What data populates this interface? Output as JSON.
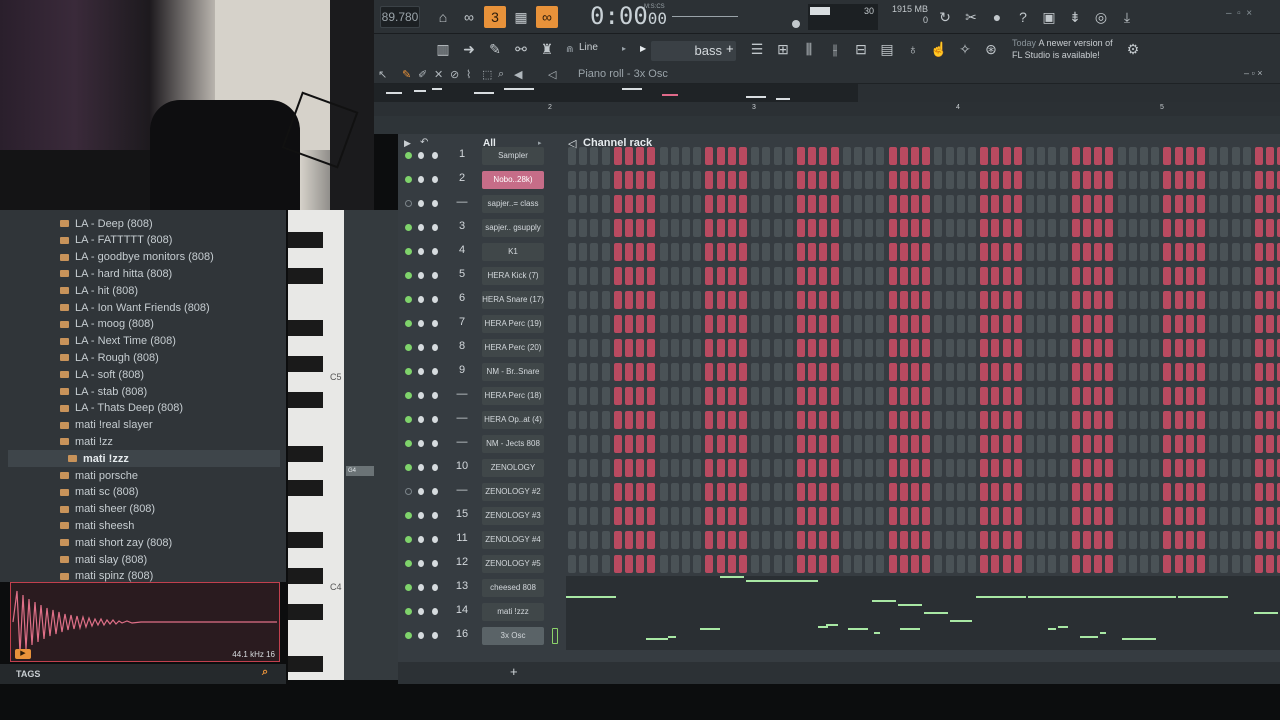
{
  "topbar": {
    "tempo": "89.780",
    "time": "0:00",
    "time_small": "00",
    "time_label": "M:S:CS",
    "cpu_value": "30",
    "memory": "1915 MB",
    "memory_sub": "0",
    "pattern": "bass",
    "snap": "Line",
    "news_title": "Today",
    "news_line1": "A newer version of",
    "news_line2": "FL Studio is available!"
  },
  "piano_roll": {
    "title": "Piano roll - 3x Osc"
  },
  "timeline": [
    "2",
    "3",
    "4",
    "5"
  ],
  "browser": {
    "items": [
      "LA - Deep (808)",
      "LA - FATTTTT (808)",
      "LA - goodbye monitors (808)",
      "LA - hard hitta (808)",
      "LA - hit (808)",
      "LA - Ion Want Friends (808)",
      "LA - moog (808)",
      "LA - Next Time (808)",
      "LA - Rough (808)",
      "LA - soft (808)",
      "LA - stab (808)",
      "LA - Thats Deep (808)",
      "mati !real slayer",
      "mati !zz",
      "mati !zzz",
      "mati porsche",
      "mati sc (808)",
      "mati sheer (808)",
      "mati sheesh",
      "mati short zay (808)",
      "mati slay (808)",
      "mati spinz (808)"
    ],
    "selected_index": 14,
    "sample_rate": "44.1 kHz 16",
    "tags_label": "TAGS"
  },
  "keyboard": {
    "c5": "C5",
    "c4": "C4",
    "g4": "G4"
  },
  "channel_rack": {
    "title": "Channel rack",
    "filter": "All",
    "add_label": "+",
    "channels": [
      {
        "num": "1",
        "name": "Sampler",
        "on": true
      },
      {
        "num": "2",
        "name": "Nobo..28k)",
        "on": true,
        "highlight": true
      },
      {
        "num": "—",
        "name": "sapjer..= class",
        "on": false
      },
      {
        "num": "3",
        "name": "sapjer.. gsupply",
        "on": true
      },
      {
        "num": "4",
        "name": "K1",
        "on": true
      },
      {
        "num": "5",
        "name": "HERA Kick (7)",
        "on": true
      },
      {
        "num": "6",
        "name": "HERA Snare (17)",
        "on": true
      },
      {
        "num": "7",
        "name": "HERA Perc (19)",
        "on": true
      },
      {
        "num": "8",
        "name": "HERA Perc (20)",
        "on": true
      },
      {
        "num": "9",
        "name": "NM - Br..Snare",
        "on": true
      },
      {
        "num": "—",
        "name": "HERA Perc (18)",
        "on": true
      },
      {
        "num": "—",
        "name": "HERA Op..at (4)",
        "on": true
      },
      {
        "num": "—",
        "name": "NM - Jects 808",
        "on": true
      },
      {
        "num": "10",
        "name": "ZENOLOGY",
        "on": true
      },
      {
        "num": "—",
        "name": "ZENOLOGY #2",
        "on": false
      },
      {
        "num": "15",
        "name": "ZENOLOGY #3",
        "on": true
      },
      {
        "num": "11",
        "name": "ZENOLOGY #4",
        "on": true
      },
      {
        "num": "12",
        "name": "ZENOLOGY #5",
        "on": true
      },
      {
        "num": "13",
        "name": "cheesed 808",
        "on": true
      },
      {
        "num": "14",
        "name": "mati !zzz",
        "on": true
      },
      {
        "num": "16",
        "name": "3x Osc",
        "on": true,
        "current": true
      }
    ],
    "step_pattern": [
      0,
      0,
      0,
      0,
      1,
      1,
      1,
      1,
      0,
      0,
      0,
      0,
      1,
      1,
      1,
      1
    ]
  },
  "colors": {
    "accent": "#e8923a",
    "step_on": "#b94a60",
    "step_off": "#4a5256",
    "led": "#7fd36b",
    "note": "#a8e8a4"
  }
}
